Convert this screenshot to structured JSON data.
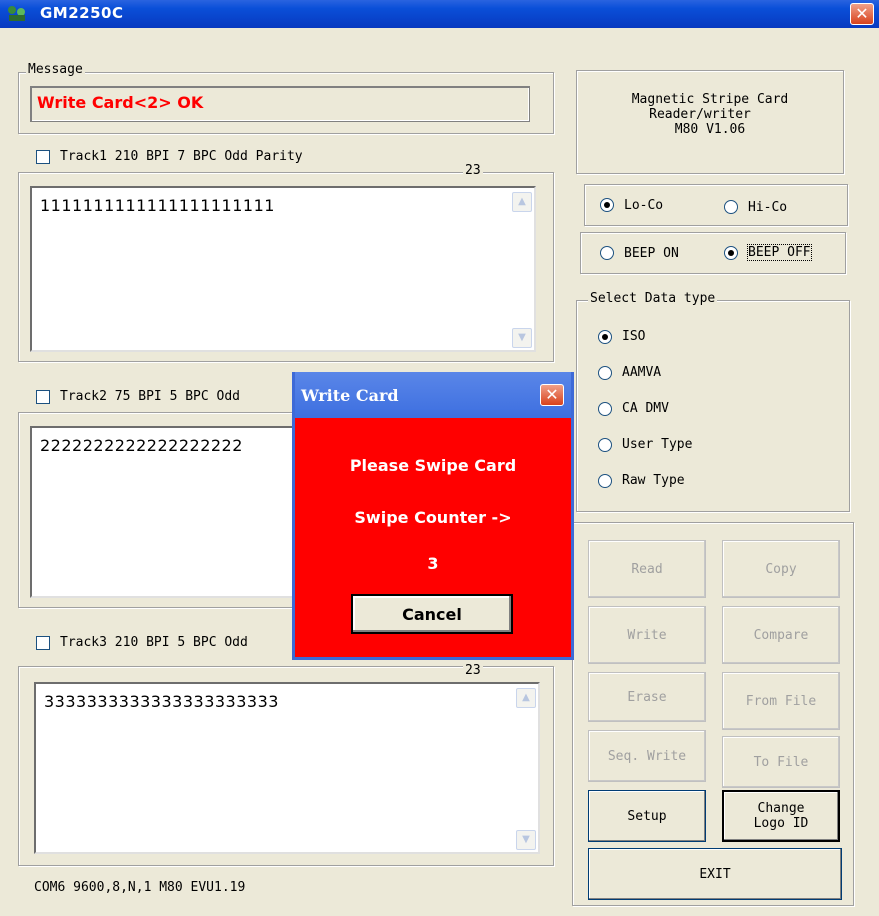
{
  "window": {
    "title": "GM2250C",
    "close_label": "✕"
  },
  "message": {
    "legend": "Message",
    "text": "Write Card<2> OK"
  },
  "tracks": [
    {
      "label": "Track1 210 BPI 7 BPC Odd Parity",
      "count": "23",
      "value": "1111111111111111111111"
    },
    {
      "label": "Track2 75 BPI 5 BPC Odd",
      "count": "",
      "value": "2222222222222222222"
    },
    {
      "label": "Track3 210 BPI 5 BPC Odd",
      "count": "23",
      "value": "3333333333333333333333"
    }
  ],
  "device_info": {
    "line1": "Magnetic Stripe Card",
    "line2": "Reader/writer",
    "line3": "M80  V1.06"
  },
  "coercivity": {
    "options": [
      "Lo-Co",
      "Hi-Co"
    ],
    "selected": "Lo-Co"
  },
  "beep": {
    "options": [
      "BEEP ON",
      "BEEP OFF"
    ],
    "selected": "BEEP OFF"
  },
  "data_type": {
    "legend": "Select Data type",
    "options": [
      "ISO",
      "AAMVA",
      "CA DMV",
      "User Type",
      "Raw Type"
    ],
    "selected": "ISO"
  },
  "buttons": {
    "read": "Read",
    "copy": "Copy",
    "write": "Write",
    "compare": "Compare",
    "erase": "Erase",
    "from_file": "From File",
    "seq_write": "Seq. Write",
    "to_file": "To File",
    "setup": "Setup",
    "change_logo_1": "Change",
    "change_logo_2": "Logo ID",
    "exit": "EXIT"
  },
  "status": {
    "text": "COM6 9600,8,N,1  M80 EVU1.19"
  },
  "dialog": {
    "title": "Write Card",
    "line1": "Please Swipe Card",
    "line2": "Swipe Counter ->",
    "counter": "3",
    "cancel": "Cancel",
    "close_label": "✕"
  },
  "colors": {
    "title_bar": "#0a4fd8",
    "dialog_bg": "#ff0000",
    "message_text": "#ff0000",
    "window_bg": "#ece9d8"
  }
}
